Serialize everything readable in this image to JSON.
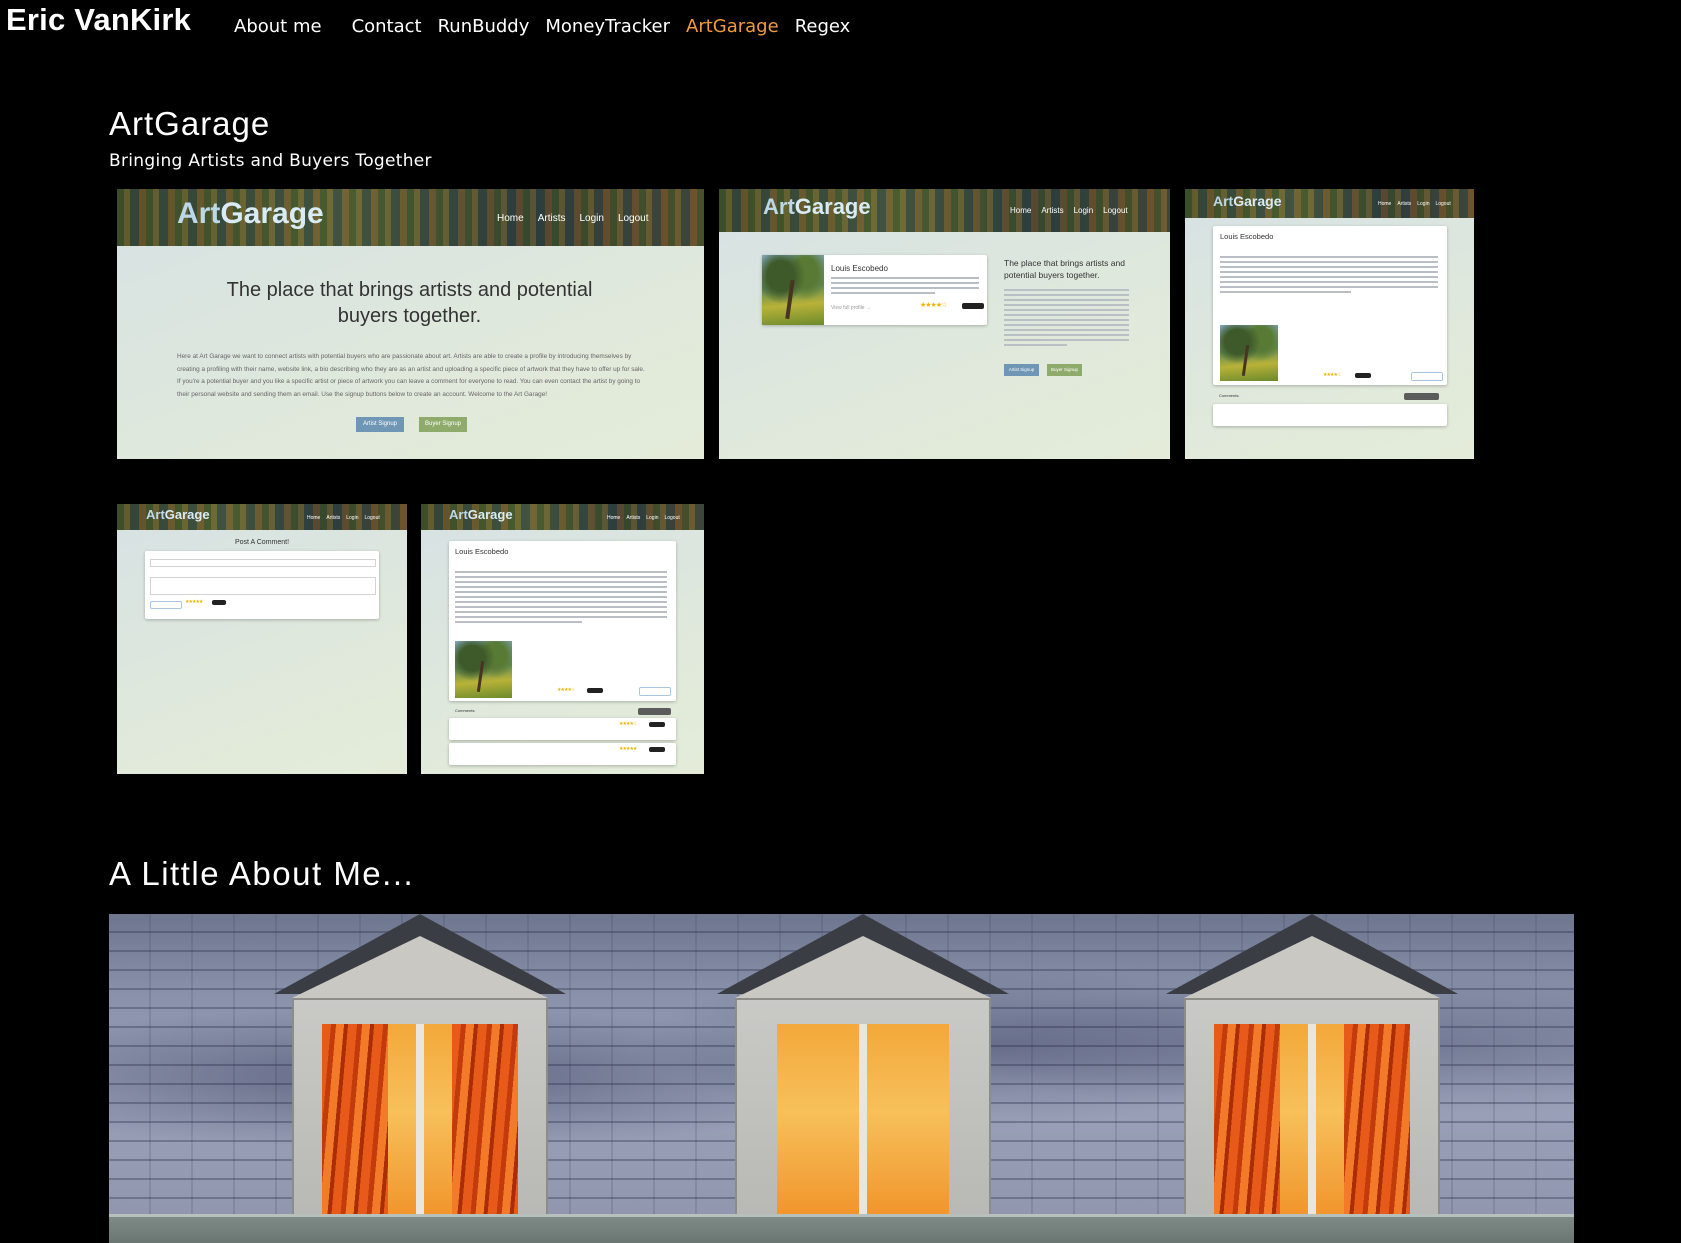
{
  "site": {
    "brand": "Eric VanKirk"
  },
  "nav": {
    "items": [
      {
        "label": "About me"
      },
      {
        "label": "Contact"
      },
      {
        "label": "RunBuddy"
      },
      {
        "label": "MoneyTracker"
      },
      {
        "label": "ArtGarage",
        "active": true
      },
      {
        "label": "Regex"
      }
    ],
    "active_color": "#f09a3e"
  },
  "project": {
    "title": "ArtGarage",
    "subtitle": "Bringing Artists and Buyers Together",
    "screenshots": {
      "logo_art": "Art",
      "logo_garage": "Garage",
      "nav": [
        "Home",
        "Artists",
        "Login",
        "Logout"
      ],
      "home": {
        "headline": "The place that brings artists and potential buyers together.",
        "body": "Here at Art Garage we want to connect artists with potential buyers who are passionate about art. Artists are able to create a profile by introducing themselves by creating a profiling with their name, website link, a bio describing who they are as an artist and uploading a specific piece of artwork that they have to offer up for sale. If you're a potential buyer and you like a specific artist or piece of artwork you can leave a comment for everyone to read. You can even contact the artist by going to their personal website and sending them an email. Use the signup buttons below to create an account. Welcome to the Art Garage!",
        "artist_signup": "Artist Signup",
        "buyer_signup": "Buyer Signup"
      },
      "artist_name": "Louis Escobedo",
      "view_profile": "View full profile →",
      "comment_form_title": "Post A Comment!",
      "comments_label": "Comments:"
    }
  },
  "about": {
    "title": "A Little About Me..."
  }
}
